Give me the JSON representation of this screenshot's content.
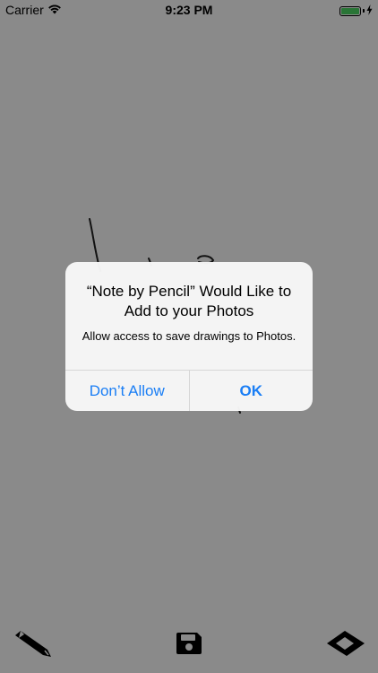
{
  "status_bar": {
    "carrier": "Carrier",
    "time": "9:23 PM",
    "battery_level_fraction": 1.0,
    "battery_color": "#4cd964"
  },
  "toolbar": {
    "pencil_icon": "pencil-icon",
    "save_icon": "floppy-disk-icon",
    "eraser_icon": "eraser-icon"
  },
  "alert": {
    "title": "“Note by Pencil” Would Like to Add to your Photos",
    "message": "Allow access to save drawings to Photos.",
    "dont_allow_label": "Don’t Allow",
    "ok_label": "OK",
    "accent_color": "#1a7ef5"
  }
}
